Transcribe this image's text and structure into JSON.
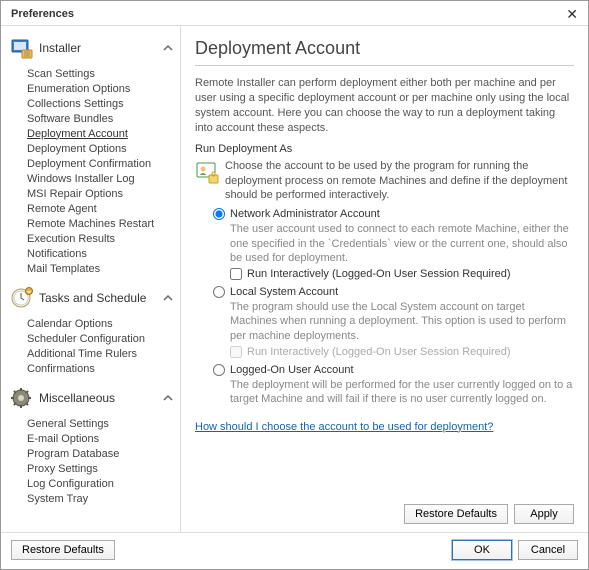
{
  "window": {
    "title": "Preferences"
  },
  "sidebar": {
    "sections": [
      {
        "label": "Installer",
        "items": [
          {
            "label": "Scan Settings"
          },
          {
            "label": "Enumeration Options"
          },
          {
            "label": "Collections Settings"
          },
          {
            "label": "Software Bundles"
          },
          {
            "label": "Deployment Account"
          },
          {
            "label": "Deployment Options"
          },
          {
            "label": "Deployment Confirmation"
          },
          {
            "label": "Windows Installer Log"
          },
          {
            "label": "MSI Repair Options"
          },
          {
            "label": "Remote Agent"
          },
          {
            "label": "Remote Machines Restart"
          },
          {
            "label": "Execution Results"
          },
          {
            "label": "Notifications"
          },
          {
            "label": "Mail Templates"
          }
        ]
      },
      {
        "label": "Tasks and Schedule",
        "items": [
          {
            "label": "Calendar Options"
          },
          {
            "label": "Scheduler Configuration"
          },
          {
            "label": "Additional Time Rulers"
          },
          {
            "label": "Confirmations"
          }
        ]
      },
      {
        "label": "Miscellaneous",
        "items": [
          {
            "label": "General Settings"
          },
          {
            "label": "E-mail Options"
          },
          {
            "label": "Program Database"
          },
          {
            "label": "Proxy Settings"
          },
          {
            "label": "Log Configuration"
          },
          {
            "label": "System Tray"
          }
        ]
      }
    ]
  },
  "content": {
    "heading": "Deployment Account",
    "intro": "Remote Installer can perform deployment either both per machine and per user using a specific deployment account or per machine only using the local system account. Here you can choose the way to run a deployment taking into account these aspects.",
    "group_label": "Run Deployment As",
    "group_desc": "Choose the account to be used by the program for running the deployment process on remote Machines and define if the deployment should be performed interactively.",
    "opts": {
      "r1": "Network Administrator Account",
      "r1_desc": "The user account used to connect to each remote Machine, either the one specified in the `Credentials` view or the current one, should also be used for deployment.",
      "r1_sub": "Run Interactively (Logged-On User Session Required)",
      "r2": "Local System Account",
      "r2_desc": "The program should use the Local System account on target Machines when running a deployment. This option is used to perform per machine deployments.",
      "r2_sub": "Run Interactively (Logged-On User Session Required)",
      "r3": "Logged-On User Account",
      "r3_desc": "The deployment will be performed for the user currently logged on to a target Machine and will fail if there is no user currently logged on."
    },
    "help_link": "How should I choose the account to be used for deployment?"
  },
  "buttons": {
    "restore_defaults": "Restore Defaults",
    "apply": "Apply",
    "ok": "OK",
    "cancel": "Cancel"
  }
}
